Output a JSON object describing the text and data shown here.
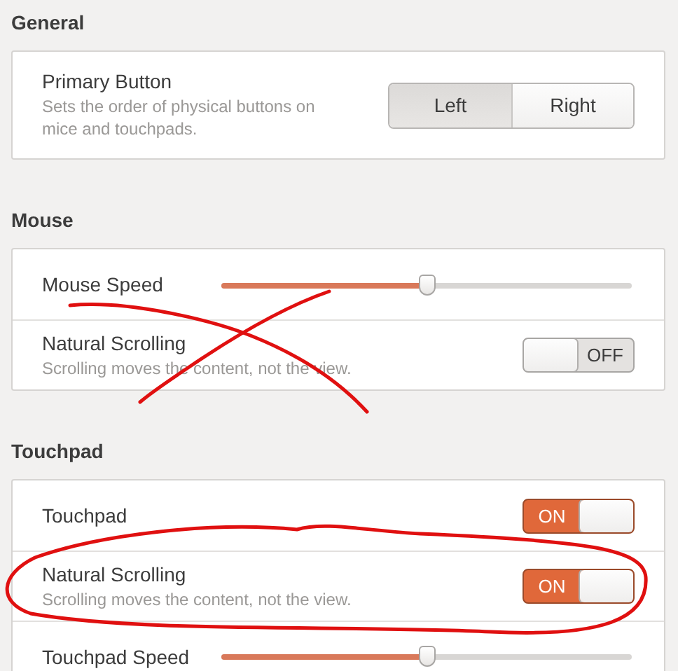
{
  "sections": [
    {
      "title": "General",
      "rows": [
        {
          "kind": "choice",
          "label": "Primary Button",
          "description": "Sets the order of physical buttons on mice and touchpads.",
          "options": [
            {
              "label": "Left",
              "selected": true
            },
            {
              "label": "Right",
              "selected": false
            }
          ]
        }
      ]
    },
    {
      "title": "Mouse",
      "rows": [
        {
          "kind": "slider",
          "label": "Mouse Speed",
          "level": 0.5
        },
        {
          "kind": "switch",
          "label": "Natural Scrolling",
          "description": "Scrolling moves the content, not the view.",
          "on": false,
          "state_text": "OFF"
        }
      ]
    },
    {
      "title": "Touchpad",
      "rows": [
        {
          "kind": "switch",
          "label": "Touchpad",
          "on": true,
          "state_text": "ON"
        },
        {
          "kind": "switch",
          "label": "Natural Scrolling",
          "description": "Scrolling moves the content, not the view.",
          "on": true,
          "state_text": "ON"
        },
        {
          "kind": "slider",
          "label": "Touchpad Speed",
          "level": 0.5
        }
      ]
    }
  ],
  "annotations": [
    {
      "kind": "cross",
      "color": "#e01010"
    },
    {
      "kind": "loop",
      "color": "#e01010"
    }
  ]
}
